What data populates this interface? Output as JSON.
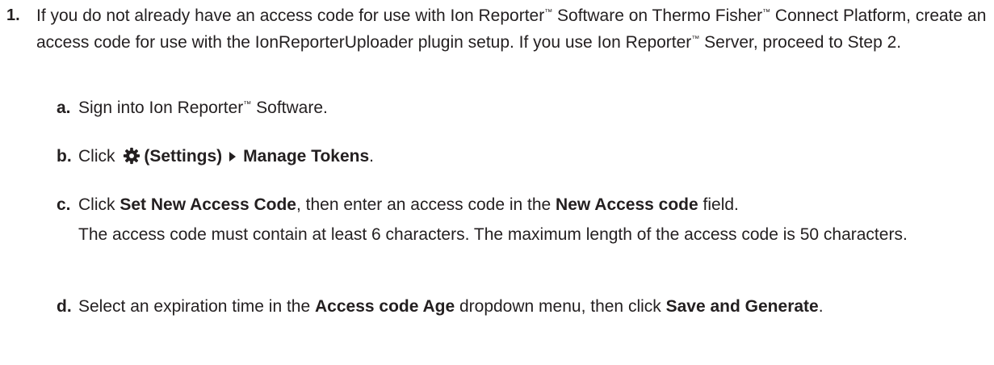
{
  "step": {
    "number": "1.",
    "text_1": "If you do not already have an access code for use with Ion Reporter",
    "tm": "™",
    "text_2": " Software on Thermo Fisher",
    "text_3": " Connect Platform, create an access code for use with the IonReporterUploader plugin setup. If you use Ion Reporter",
    "text_4": " Server, proceed to Step 2."
  },
  "substeps": {
    "a": {
      "letter": "a.",
      "text_1": "Sign into Ion Reporter",
      "text_2": " Software."
    },
    "b": {
      "letter": "b.",
      "click": "Click ",
      "settings": "(Settings)",
      "manage": "Manage Tokens",
      "period": ".",
      "icon": "gear-icon"
    },
    "c": {
      "letter": "c.",
      "click": "Click ",
      "set_new": "Set New Access Code",
      "mid": ", then enter an access code in the ",
      "field_name": "New Access code",
      "end": " field.",
      "note": "The access code must contain at least 6 characters. The maximum length of the access code is 50 characters."
    },
    "d": {
      "letter": "d.",
      "text_1": "Select an expiration time in the ",
      "age": "Access code Age",
      "text_2": " dropdown menu, then click ",
      "save": "Save and Generate",
      "period": "."
    }
  },
  "colors": {
    "text": "#231f20",
    "icon": "#231f20"
  }
}
